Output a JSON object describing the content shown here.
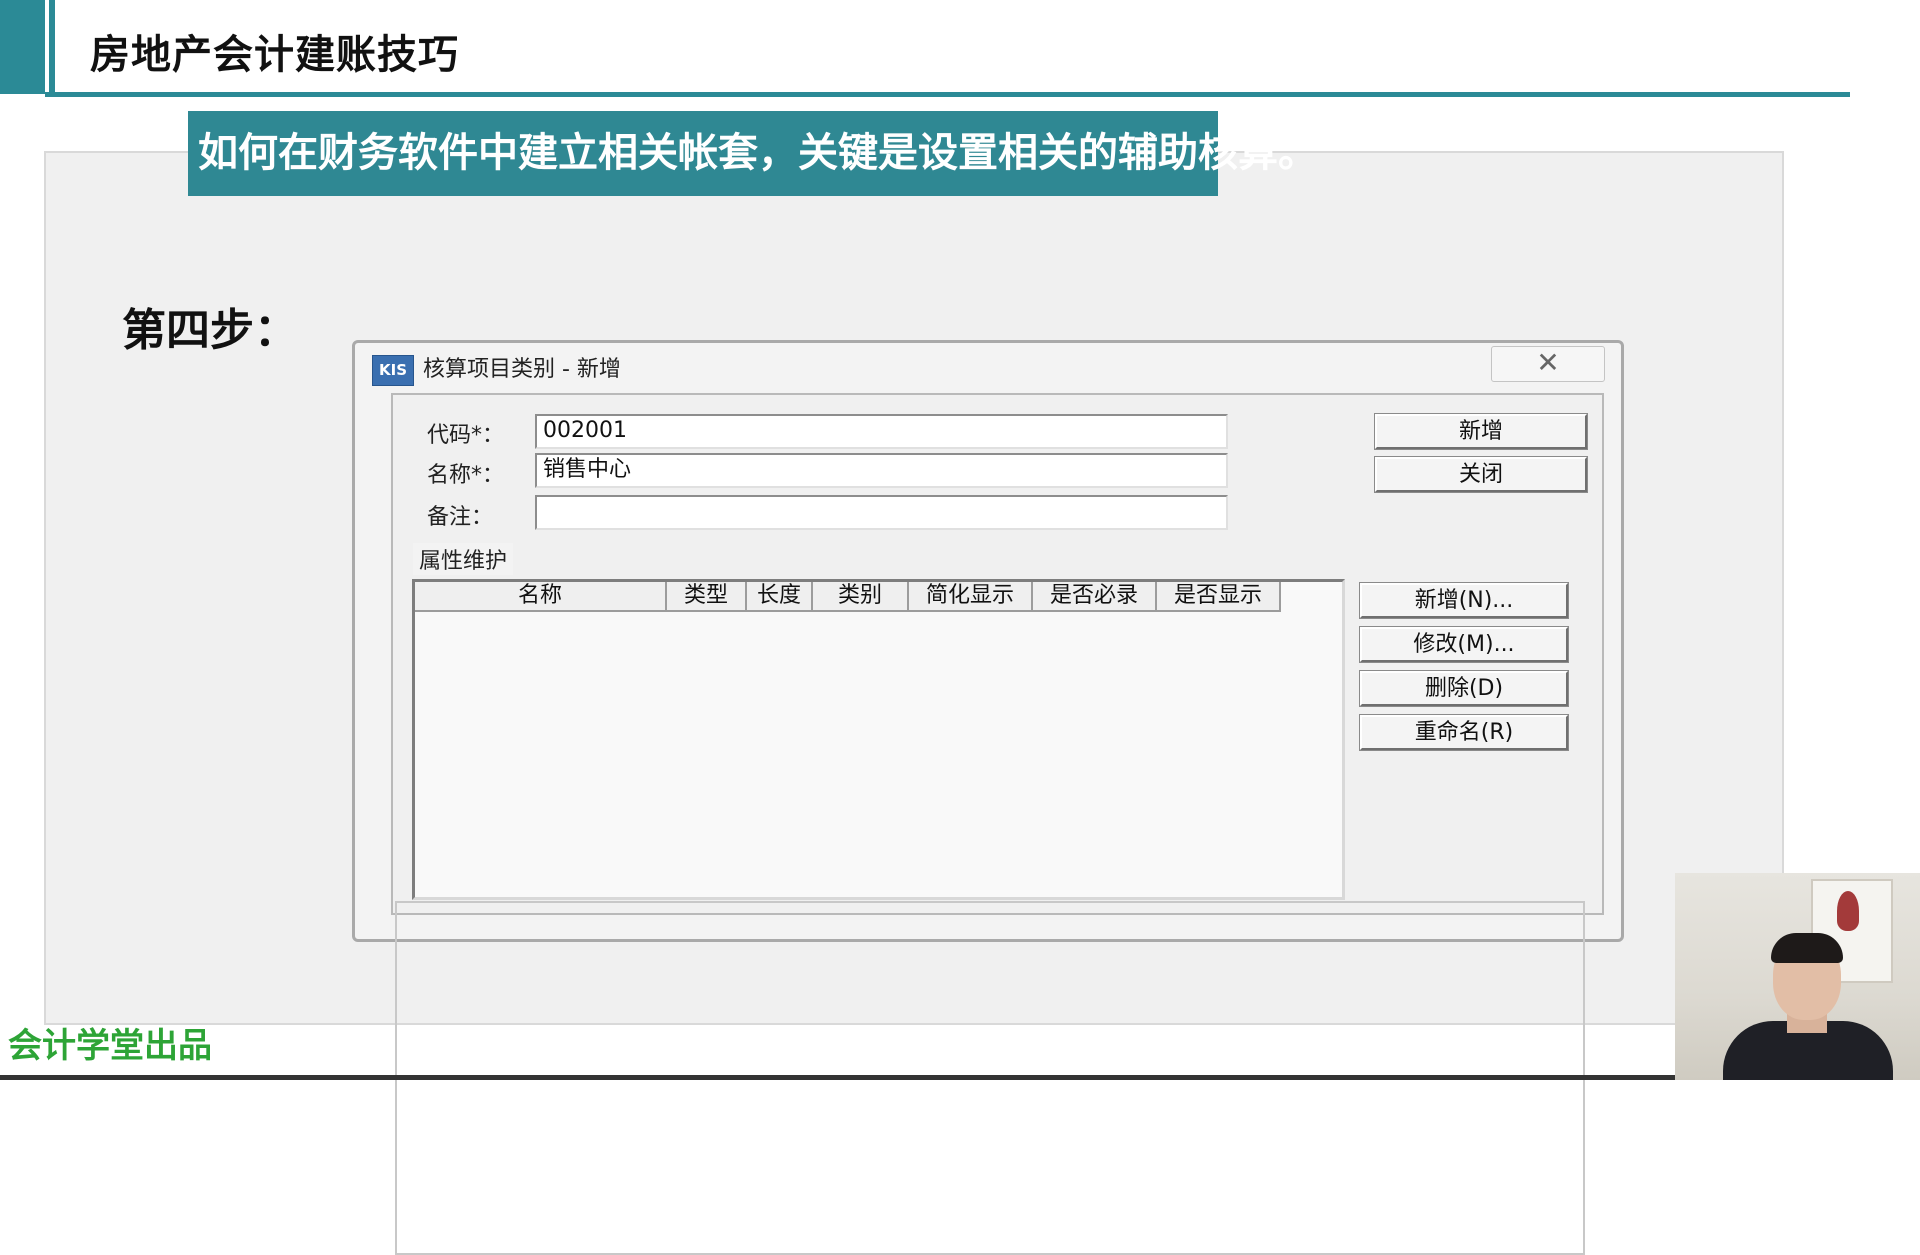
{
  "slide": {
    "title": "房地产会计建账技巧",
    "banner": "如何在财务软件中建立相关帐套，关键是设置相关的辅助核算。",
    "step": "第四步：",
    "brand": "会计学堂出品"
  },
  "dialog": {
    "app_icon_text": "KIS",
    "title": "核算项目类别 - 新增",
    "close_glyph": "✕",
    "fields": {
      "code_label": "代码*：",
      "code_value": "002001",
      "name_label": "名称*：",
      "name_value": "销售中心",
      "note_label": "备注：",
      "note_value": ""
    },
    "buttons": {
      "add": "新增",
      "close": "关闭"
    },
    "attributes": {
      "group_label": "属性维护",
      "columns": [
        "名称",
        "类型",
        "长度",
        "类别",
        "简化显示",
        "是否必录",
        "是否显示"
      ],
      "rows": [],
      "buttons": {
        "add": "新增(N)...",
        "edit": "修改(M)...",
        "delete": "删除(D)",
        "rename": "重命名(R)"
      }
    }
  },
  "colors": {
    "accent": "#2b8a96",
    "banner": "#2f8893",
    "brand": "#2da436"
  }
}
